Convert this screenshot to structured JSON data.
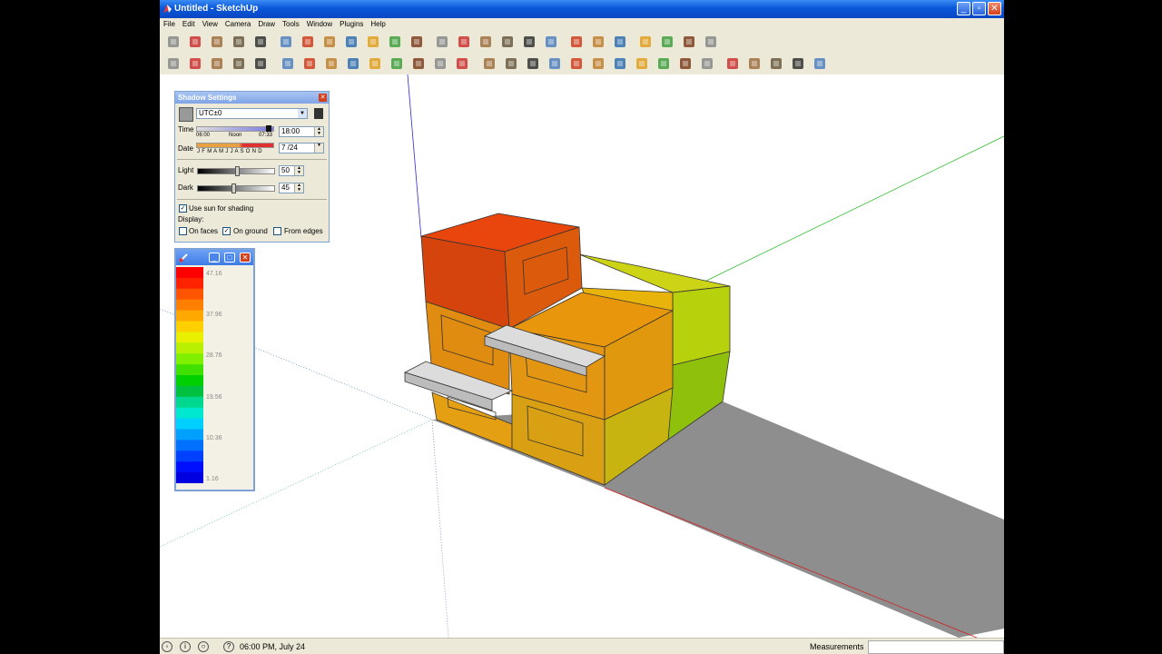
{
  "window": {
    "title": "Untitled - SketchUp"
  },
  "menu": [
    "File",
    "Edit",
    "View",
    "Camera",
    "Draw",
    "Tools",
    "Window",
    "Plugins",
    "Help"
  ],
  "toolbar1": [
    "select-icon",
    "pencil-icon",
    "rectangle-icon",
    "circle-icon",
    "arc-icon",
    "eraser-icon",
    "paint-bucket-icon",
    "tape-measure-icon",
    "push-pull-icon",
    "move-icon",
    "rotate-icon",
    "offset-icon",
    "follow-me-icon",
    "orbit-icon",
    "pan-icon",
    "zoom-icon",
    "zoom-extents-icon",
    "section-icon",
    "component-icon",
    "warehouse-icon",
    "share-icon",
    "get-model-icon",
    "extension-icon",
    "materials-icon",
    "layers-icon"
  ],
  "toolbar2": [
    "export-icon",
    "import-icon",
    "save-icon",
    "print-icon",
    "warning-icon",
    "cube-icon",
    "elevation-icon",
    "text-icon",
    "text-icon-2",
    "text-icon-3",
    "curve-icon",
    "swap-icon",
    "axis-icon",
    "help-icon",
    "png-icon",
    "wireframe-icon",
    "hidden-line-icon",
    "shaded-icon",
    "house-icon",
    "solar-icon",
    "object-icon",
    "object-icon-2",
    "grid-icon",
    "chart-icon",
    "camera-icon",
    "first-frame-icon",
    "rewind-icon",
    "play-icon",
    "fast-forward-icon",
    "last-frame-icon"
  ],
  "shadow": {
    "title": "Shadow Settings",
    "timezone": "UTC±0",
    "time_label": "Time",
    "time_ticks": [
      "06:00",
      "Noon",
      "07:33"
    ],
    "time_value": "18:00",
    "date_label": "Date",
    "months": "J F M A M J J A S O N D",
    "date_value": "7 /24",
    "light_label": "Light",
    "light_value": "50",
    "light_level": 0.5,
    "dark_label": "Dark",
    "dark_value": "45",
    "dark_level": 0.45,
    "use_sun": "Use sun for shading",
    "display_label": "Display:",
    "on_faces": "On faces",
    "on_ground": "On ground",
    "from_edges": "From edges"
  },
  "legend": {
    "values": [
      "47.16",
      "37.96",
      "28.76",
      "19.56",
      "10.36",
      "1.16"
    ]
  },
  "status": {
    "text": "06:00 PM, July 24",
    "measurements": "Measurements"
  }
}
